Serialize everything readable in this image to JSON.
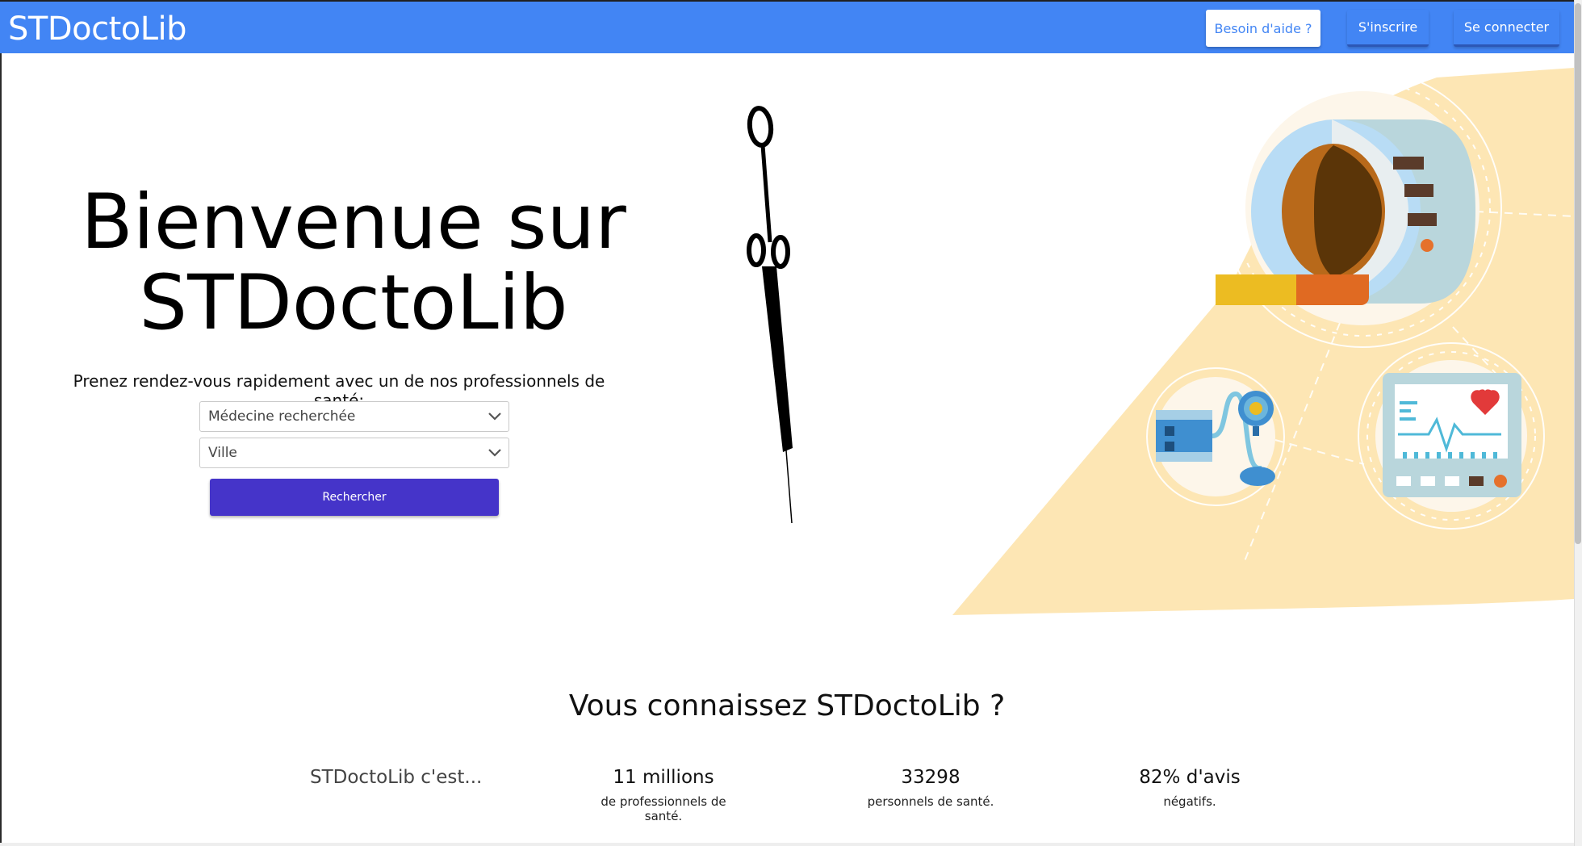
{
  "header": {
    "brand": "STDoctoLib",
    "help_label": "Besoin d'aide ?",
    "signup_label": "S'inscrire",
    "login_label": "Se connecter"
  },
  "hero": {
    "title_line1": "Bienvenue sur",
    "title_line2": "STDoctoLib",
    "subtitle": "Prenez rendez-vous rapidement avec un de nos professionnels de santé:",
    "specialty_select": {
      "selected": "Médecine recherchée"
    },
    "city_select": {
      "selected": "Ville"
    },
    "search_label": "Rechercher"
  },
  "stats": {
    "title": "Vous connaissez STDoctoLib ?",
    "intro": "STDoctoLib c'est...",
    "items": [
      {
        "value": "11 millions",
        "label": "de professionnels de santé."
      },
      {
        "value": "33298",
        "label": "personnels de santé."
      },
      {
        "value": "82% d'avis",
        "label": "négatifs."
      }
    ]
  },
  "colors": {
    "navbar": "#4285f4",
    "search_button": "#4534c9",
    "illustration_background": "#fde6b4"
  },
  "icons": [
    "syringe-icon",
    "mri-scanner-icon",
    "blood-pressure-icon",
    "heart-monitor-icon",
    "chevron-down-icon"
  ]
}
